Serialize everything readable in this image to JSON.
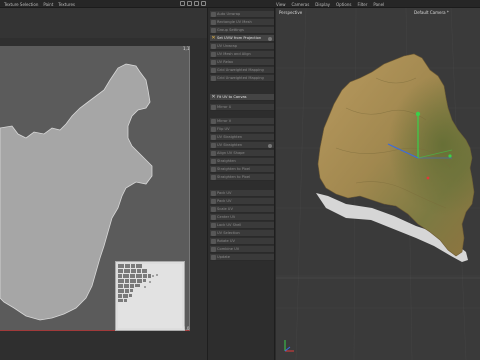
{
  "topbar": {
    "left_menu": [
      "Texture Selection",
      "Paint",
      "Textures"
    ],
    "right_menu": [
      "View",
      "Cameras",
      "Display",
      "Options",
      "Filter",
      "Panel"
    ]
  },
  "uv_editor": {
    "corner_top_right": "1,1",
    "corner_bottom_right": "1,0"
  },
  "tool_panel": {
    "items": [
      {
        "label": "Auto Unwrap",
        "active": false
      },
      {
        "label": "Rectangle UV Mesh",
        "active": false
      },
      {
        "label": "Group Settings",
        "active": false
      },
      {
        "label": "Set UVW from Projection",
        "active": true
      },
      {
        "label": "UV Unwrap",
        "active": false
      },
      {
        "label": "UV Mesh and Align",
        "active": false
      },
      {
        "label": "UV Relax",
        "active": false
      },
      {
        "label": "Grid Unweighted Mapping",
        "active": false
      },
      {
        "label": "Grid Unweighted Mapping",
        "active": false
      },
      {
        "label": "Fit UV to Canvas",
        "active": true
      },
      {
        "label": "Mirror U",
        "active": false
      },
      {
        "label": "Mirror V",
        "active": false
      },
      {
        "label": "Flip UV",
        "active": false
      },
      {
        "label": "UV Straighten",
        "active": false
      },
      {
        "label": "UV Straighten",
        "active": false
      },
      {
        "label": "Align UV Shape",
        "active": false
      },
      {
        "label": "Straighten",
        "active": false
      },
      {
        "label": "Straighten to Pixel",
        "active": false
      },
      {
        "label": "Straighten to Pixel",
        "active": false
      },
      {
        "label": "Pack UV",
        "active": false
      },
      {
        "label": "Pack UV",
        "active": false
      },
      {
        "label": "Scale UV",
        "active": false
      },
      {
        "label": "Center UV",
        "active": false
      },
      {
        "label": "Lock UV Shell",
        "active": false
      },
      {
        "label": "UV Selection",
        "active": false
      },
      {
        "label": "Rotate UV",
        "active": false
      },
      {
        "label": "Combine UV",
        "active": false
      },
      {
        "label": "Update",
        "active": false
      }
    ]
  },
  "viewport": {
    "view_name": "Perspective",
    "camera": "Default Camera *"
  },
  "colors": {
    "accent": "#e6b84a",
    "axis_x": "#e03a3a",
    "axis_y": "#3ad04a",
    "axis_z": "#3a6ae0"
  }
}
